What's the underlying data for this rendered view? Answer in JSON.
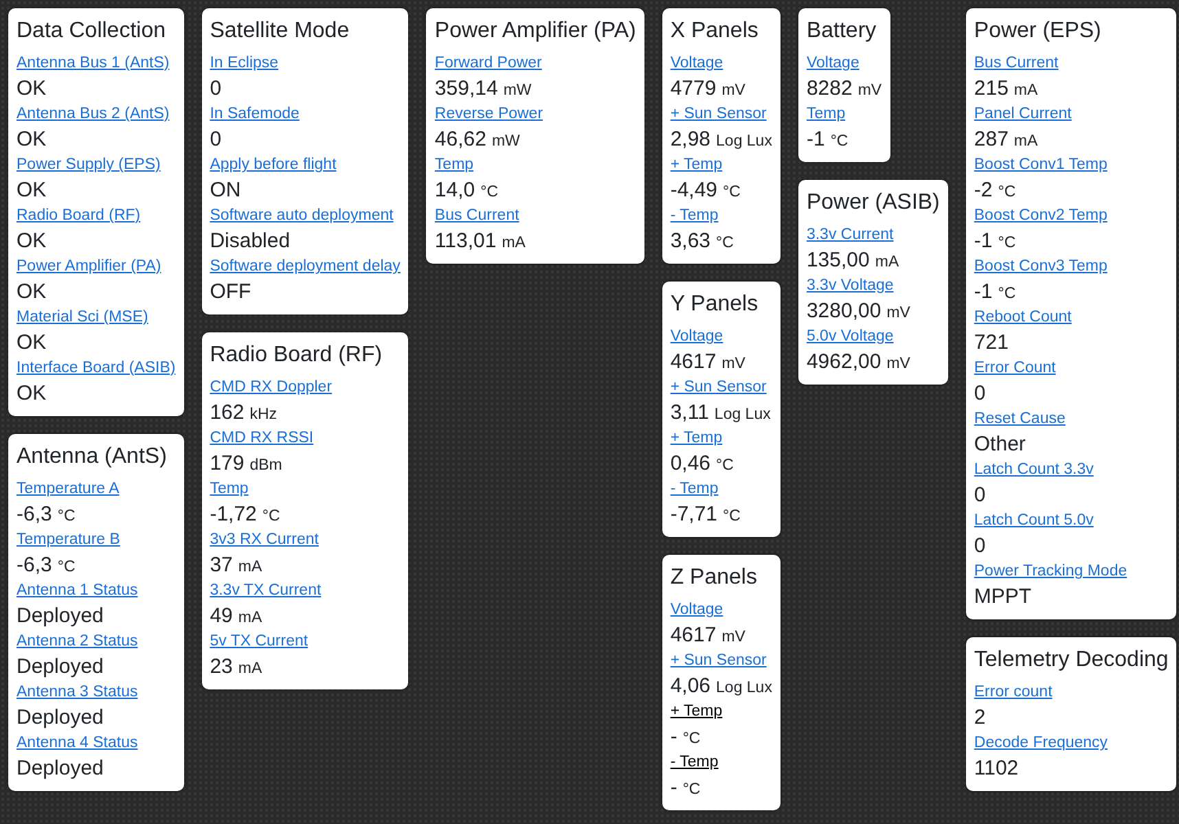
{
  "columns": [
    {
      "cards": [
        {
          "title": "Data Collection",
          "fields": [
            {
              "label": "Antenna Bus 1 (AntS)",
              "kind": "link",
              "value": "OK"
            },
            {
              "label": "Antenna Bus 2 (AntS)",
              "kind": "link",
              "value": "OK"
            },
            {
              "label": "Power Supply (EPS)",
              "kind": "link",
              "value": "OK"
            },
            {
              "label": "Radio Board (RF)",
              "kind": "link",
              "value": "OK"
            },
            {
              "label": "Power Amplifier (PA)",
              "kind": "link",
              "value": "OK"
            },
            {
              "label": "Material Sci (MSE)",
              "kind": "link",
              "value": "OK"
            },
            {
              "label": "Interface Board (ASIB)",
              "kind": "link",
              "value": "OK"
            }
          ]
        },
        {
          "title": "Antenna (AntS)",
          "fields": [
            {
              "label": "Temperature A",
              "kind": "link",
              "value": "-6,3",
              "unit": "°C"
            },
            {
              "label": "Temperature B",
              "kind": "link",
              "value": "-6,3",
              "unit": "°C"
            },
            {
              "label": "Antenna 1 Status",
              "kind": "link",
              "value": "Deployed"
            },
            {
              "label": "Antenna 2 Status",
              "kind": "link",
              "value": "Deployed"
            },
            {
              "label": "Antenna 3 Status",
              "kind": "link",
              "value": "Deployed"
            },
            {
              "label": "Antenna 4 Status",
              "kind": "link",
              "value": "Deployed"
            }
          ]
        }
      ]
    },
    {
      "cards": [
        {
          "title": "Satellite Mode",
          "fields": [
            {
              "label": "In Eclipse",
              "kind": "link",
              "value": "0"
            },
            {
              "label": "In Safemode",
              "kind": "link",
              "value": "0"
            },
            {
              "label": "Apply before flight",
              "kind": "link",
              "value": "ON"
            },
            {
              "label": "Software auto deployment",
              "kind": "link",
              "value": "Disabled"
            },
            {
              "label": "Software deployment delay",
              "kind": "link",
              "value": "OFF"
            }
          ]
        },
        {
          "title": "Radio Board (RF)",
          "fields": [
            {
              "label": "CMD RX Doppler",
              "kind": "link",
              "value": "162",
              "unit": "kHz"
            },
            {
              "label": "CMD RX RSSI",
              "kind": "link",
              "value": "179",
              "unit": "dBm"
            },
            {
              "label": "Temp",
              "kind": "link",
              "value": "-1,72",
              "unit": "°C"
            },
            {
              "label": "3v3 RX Current",
              "kind": "link",
              "value": "37",
              "unit": "mA"
            },
            {
              "label": "3.3v TX Current",
              "kind": "link",
              "value": "49",
              "unit": "mA"
            },
            {
              "label": "5v TX Current",
              "kind": "link",
              "value": "23",
              "unit": "mA"
            }
          ]
        }
      ]
    },
    {
      "cards": [
        {
          "title": "Power Amplifier (PA)",
          "fields": [
            {
              "label": "Forward Power",
              "kind": "link",
              "value": "359,14",
              "unit": "mW"
            },
            {
              "label": "Reverse Power",
              "kind": "link",
              "value": "46,62",
              "unit": "mW"
            },
            {
              "label": "Temp",
              "kind": "link",
              "value": "14,0",
              "unit": "°C"
            },
            {
              "label": "Bus Current",
              "kind": "link",
              "value": "113,01",
              "unit": "mA"
            }
          ]
        }
      ]
    },
    {
      "cards": [
        {
          "title": "X Panels",
          "fields": [
            {
              "label": "Voltage",
              "kind": "link",
              "value": "4779",
              "unit": "mV"
            },
            {
              "label": "+ Sun Sensor",
              "kind": "link",
              "value": "2,98",
              "unit": "Log Lux"
            },
            {
              "label": "+ Temp",
              "kind": "link",
              "value": "-4,49",
              "unit": "°C"
            },
            {
              "label": "- Temp",
              "kind": "link",
              "value": "3,63",
              "unit": "°C"
            }
          ]
        },
        {
          "title": "Y Panels",
          "fields": [
            {
              "label": "Voltage",
              "kind": "link",
              "value": "4617",
              "unit": "mV"
            },
            {
              "label": "+ Sun Sensor",
              "kind": "link",
              "value": "3,11",
              "unit": "Log Lux"
            },
            {
              "label": "+ Temp",
              "kind": "link",
              "value": "0,46",
              "unit": "°C"
            },
            {
              "label": "- Temp",
              "kind": "link",
              "value": "-7,71",
              "unit": "°C"
            }
          ]
        },
        {
          "title": "Z Panels",
          "fields": [
            {
              "label": "Voltage",
              "kind": "link",
              "value": "4617",
              "unit": "mV"
            },
            {
              "label": "+ Sun Sensor",
              "kind": "link",
              "value": "4,06",
              "unit": "Log Lux"
            },
            {
              "label": "+ Temp",
              "kind": "plain",
              "value": "-",
              "unit": "°C"
            },
            {
              "label": "- Temp",
              "kind": "plain",
              "value": "-",
              "unit": "°C"
            }
          ]
        }
      ]
    },
    {
      "cards": [
        {
          "title": "Battery",
          "fields": [
            {
              "label": "Voltage",
              "kind": "link",
              "value": "8282",
              "unit": "mV"
            },
            {
              "label": "Temp",
              "kind": "link",
              "value": "-1",
              "unit": "°C"
            }
          ]
        },
        {
          "title": "Power (ASIB)",
          "fields": [
            {
              "label": "3.3v Current",
              "kind": "link",
              "value": "135,00",
              "unit": "mA"
            },
            {
              "label": "3.3v Voltage",
              "kind": "link",
              "value": "3280,00",
              "unit": "mV"
            },
            {
              "label": "5.0v Voltage",
              "kind": "link",
              "value": "4962,00",
              "unit": "mV"
            }
          ]
        }
      ]
    },
    {
      "cards": [
        {
          "title": "Power (EPS)",
          "fields": [
            {
              "label": "Bus Current",
              "kind": "link",
              "value": "215",
              "unit": "mA"
            },
            {
              "label": "Panel Current",
              "kind": "link",
              "value": "287",
              "unit": "mA"
            },
            {
              "label": "Boost Conv1 Temp",
              "kind": "link",
              "value": "-2",
              "unit": "°C"
            },
            {
              "label": "Boost Conv2 Temp",
              "kind": "link",
              "value": "-1",
              "unit": "°C"
            },
            {
              "label": "Boost Conv3 Temp",
              "kind": "link",
              "value": "-1",
              "unit": "°C"
            },
            {
              "label": "Reboot Count",
              "kind": "link",
              "value": "721"
            },
            {
              "label": "Error Count",
              "kind": "link",
              "value": "0"
            },
            {
              "label": "Reset Cause",
              "kind": "link",
              "value": "Other"
            },
            {
              "label": "Latch Count 3.3v",
              "kind": "link",
              "value": "0"
            },
            {
              "label": "Latch Count 5.0v",
              "kind": "link",
              "value": "0"
            },
            {
              "label": "Power Tracking Mode",
              "kind": "link",
              "value": "MPPT"
            }
          ]
        },
        {
          "title": "Telemetry Decoding",
          "fields": [
            {
              "label": "Error count",
              "kind": "link",
              "value": "2"
            },
            {
              "label": "Decode Frequency",
              "kind": "link",
              "value": "1102"
            }
          ]
        }
      ]
    }
  ]
}
